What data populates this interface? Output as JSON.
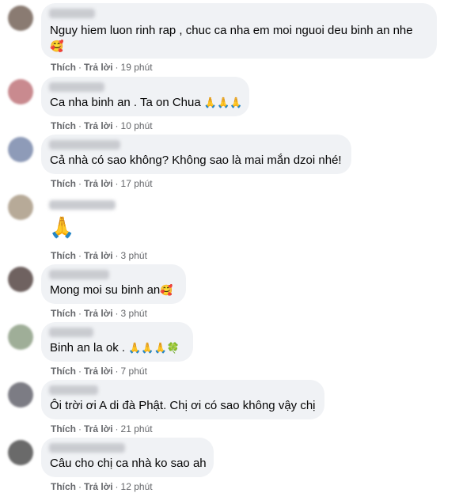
{
  "comments": [
    {
      "text": "Nguy hiem luon rinh rap , chuc ca nha em moi nguoi deu binh an nhe",
      "emoji": "🥰",
      "time": "19 phút",
      "avatar_color": "#8a7b72"
    },
    {
      "text": "Ca nha binh an . Ta on Chua",
      "emoji": "🙏🙏🙏",
      "time": "10 phút",
      "avatar_color": "#c98a8f"
    },
    {
      "text": "Cả nhà có sao không? Không sao là mai mắn dzoi nhé!",
      "emoji": "",
      "time": "17 phút",
      "avatar_color": "#8e9bb8"
    },
    {
      "text": "",
      "emoji": "🙏",
      "time": "3 phút",
      "avatar_color": "#b7aa98"
    },
    {
      "text": "Mong moi su binh an",
      "emoji": "🥰",
      "time": "3 phút",
      "avatar_color": "#6f6260"
    },
    {
      "text": "Binh an la ok .",
      "emoji": "🙏🙏🙏🍀",
      "time": "7 phút",
      "avatar_color": "#9fae98"
    },
    {
      "text": "Ôi trời ơi A di đà Phật. Chị ơi có sao không vậy chị",
      "emoji": "",
      "time": "21 phút",
      "avatar_color": "#7c7c84"
    },
    {
      "text": "Câu cho chị ca nhà ko sao ah",
      "emoji": "",
      "time": "12 phút",
      "avatar_color": "#6a6a6a"
    }
  ],
  "labels": {
    "like": "Thích",
    "reply": "Trả lời",
    "dot": "·"
  }
}
